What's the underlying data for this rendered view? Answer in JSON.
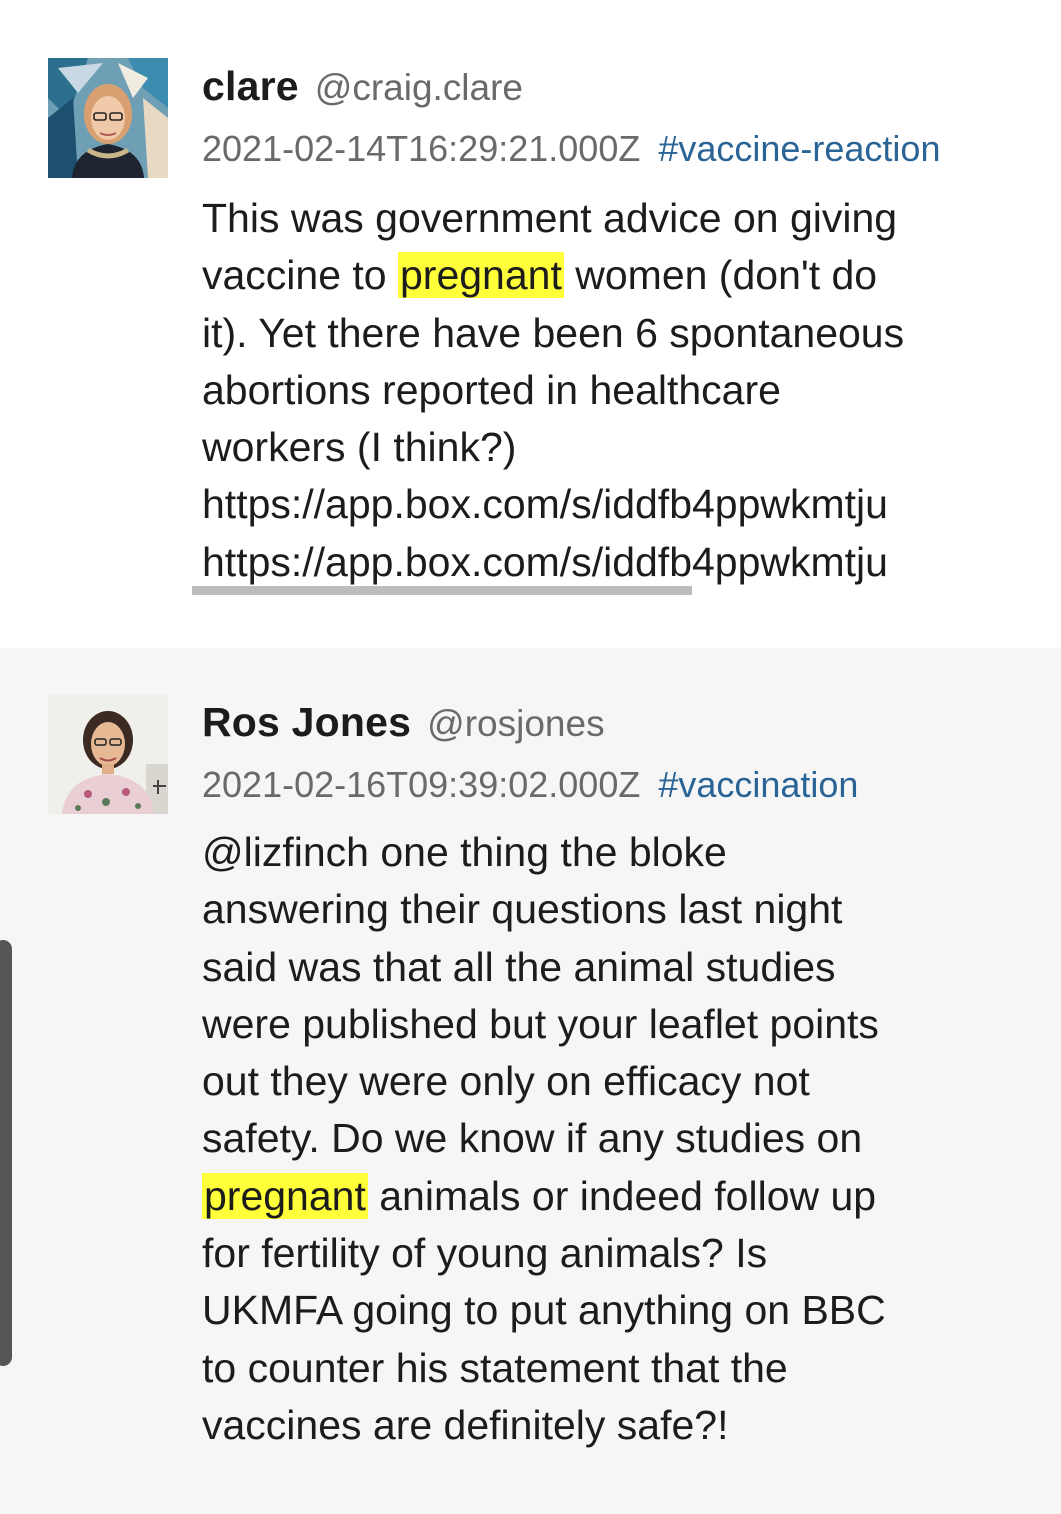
{
  "messages": [
    {
      "display_name": "clare",
      "handle": "@craig.clare",
      "timestamp": "2021-02-14T16:29:21.000Z",
      "hashtag": "#vaccine-reaction",
      "avatar_icon": "avatar-photo-icon",
      "body": {
        "line1": "This was government advice on giving",
        "line2_pre": "vaccine to ",
        "line2_hl": "pregnant",
        "line2_post": " women (don't do",
        "line3": "it). Yet there have been 6 spontaneous",
        "line4": "abortions reported in healthcare",
        "line5": "workers (I think?)",
        "link1": "https://app.box.com/s/iddfb4ppwkmtju",
        "link2": "https://app.box.com/s/iddfb4ppwkmtju"
      }
    },
    {
      "display_name": "Ros Jones",
      "handle": "@rosjones",
      "timestamp": "2021-02-16T09:39:02.000Z",
      "hashtag": "#vaccination",
      "avatar_icon": "avatar-photo-icon",
      "body": {
        "line1": "@lizfinch one thing the bloke",
        "line2": "answering their questions last night",
        "line3": "said was that all the animal studies",
        "line4": "were published but your leaflet points",
        "line5": "out they were only on efficacy not",
        "line6": "safety. Do we know if any studies on",
        "line7_hl": "pregnant",
        "line7_post": " animals or indeed follow up",
        "line8": "for fertility of young animals? Is",
        "line9": "UKMFA going to put anything on BBC",
        "line10": "to counter his statement that the",
        "line11": "vaccines are definitely safe?!"
      }
    }
  ],
  "colors": {
    "highlight": "#ffff3a",
    "hashtag": "#2a6496",
    "muted": "#6a6a6a",
    "text": "#1c1c1c",
    "alt_background": "#f6f6f6"
  }
}
